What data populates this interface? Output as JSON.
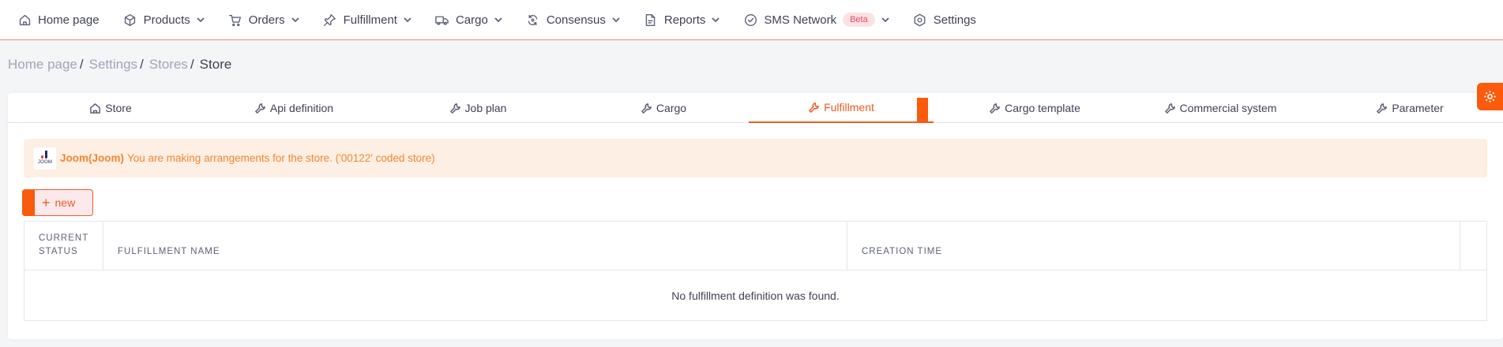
{
  "nav": {
    "items": [
      {
        "label": "Home page",
        "icon": "home-icon",
        "has_dropdown": false
      },
      {
        "label": "Products",
        "icon": "box-icon",
        "has_dropdown": true
      },
      {
        "label": "Orders",
        "icon": "cart-icon",
        "has_dropdown": true
      },
      {
        "label": "Fulfillment",
        "icon": "pin-icon",
        "has_dropdown": true
      },
      {
        "label": "Cargo",
        "icon": "truck-icon",
        "has_dropdown": true
      },
      {
        "label": "Consensus",
        "icon": "sync-icon",
        "has_dropdown": true
      },
      {
        "label": "Reports",
        "icon": "report-icon",
        "has_dropdown": true
      },
      {
        "label": "SMS Network",
        "icon": "check-circle-icon",
        "has_dropdown": true,
        "badge": "Beta"
      },
      {
        "label": "Settings",
        "icon": "gear-icon",
        "has_dropdown": false
      }
    ]
  },
  "breadcrumb": {
    "items": [
      "Home page",
      "Settings",
      "Stores",
      "Store"
    ],
    "separator": "/"
  },
  "tabs": {
    "items": [
      {
        "label": "Store",
        "icon": "home-icon"
      },
      {
        "label": "Api definition",
        "icon": "wrench-icon"
      },
      {
        "label": "Job plan",
        "icon": "wrench-icon"
      },
      {
        "label": "Cargo",
        "icon": "wrench-icon"
      },
      {
        "label": "Fulfillment",
        "icon": "wrench-icon"
      },
      {
        "label": "Cargo template",
        "icon": "wrench-icon"
      },
      {
        "label": "Commercial system",
        "icon": "wrench-icon"
      },
      {
        "label": "Parameter",
        "icon": "wrench-icon"
      }
    ],
    "active": "Fulfillment"
  },
  "notice": {
    "logo_text": "JOOM",
    "brand": "Joom(Joom)",
    "message": "You are making arrangements for the store. ('00122' coded store)"
  },
  "actions": {
    "new_label": "new"
  },
  "table": {
    "columns": [
      "CURRENT STATUS",
      "FULFILLMENT NAME",
      "CREATION TIME",
      ""
    ],
    "rows": [],
    "empty_text": "No fulfillment definition was found."
  },
  "colors": {
    "accent": "#f05a22",
    "notice_bg": "#fdefe3",
    "notice_text": "#f5862e",
    "beta_bg": "#fde2e4",
    "beta_text": "#f1416c"
  }
}
